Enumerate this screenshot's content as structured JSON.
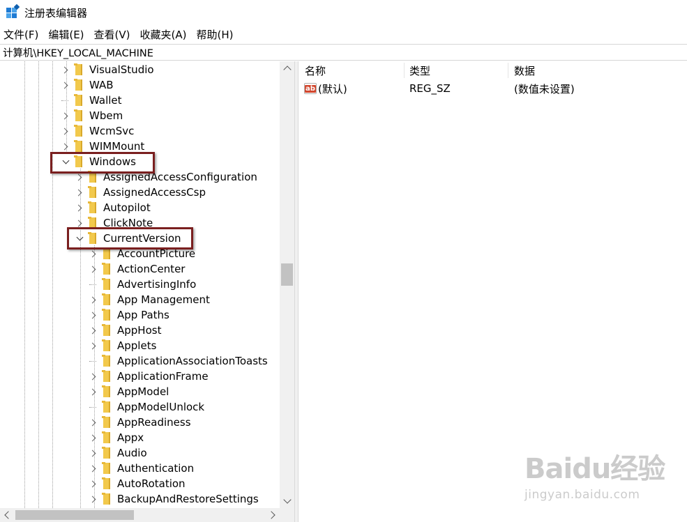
{
  "window": {
    "title": "注册表编辑器",
    "icon": "registry-editor-icon"
  },
  "menu": [
    "文件(F)",
    "编辑(E)",
    "查看(V)",
    "收藏夹(A)",
    "帮助(H)"
  ],
  "address": "计算机\\HKEY_LOCAL_MACHINE",
  "tree": {
    "items": [
      {
        "label": "VisualStudio",
        "expander": "collapsed",
        "level": 0
      },
      {
        "label": "WAB",
        "expander": "collapsed",
        "level": 0
      },
      {
        "label": "Wallet",
        "expander": "none",
        "level": 0
      },
      {
        "label": "Wbem",
        "expander": "collapsed",
        "level": 0
      },
      {
        "label": "WcmSvc",
        "expander": "collapsed",
        "level": 0
      },
      {
        "label": "WIMMount",
        "expander": "collapsed",
        "level": 0
      },
      {
        "label": "Windows",
        "expander": "expanded",
        "level": 0,
        "highlighted": true
      },
      {
        "label": "AssignedAccessConfiguration",
        "expander": "collapsed",
        "level": 1
      },
      {
        "label": "AssignedAccessCsp",
        "expander": "collapsed",
        "level": 1
      },
      {
        "label": "Autopilot",
        "expander": "collapsed",
        "level": 1
      },
      {
        "label": "ClickNote",
        "expander": "collapsed",
        "level": 1
      },
      {
        "label": "CurrentVersion",
        "expander": "expanded",
        "level": 1,
        "highlighted": true
      },
      {
        "label": "AccountPicture",
        "expander": "collapsed",
        "level": 2
      },
      {
        "label": "ActionCenter",
        "expander": "collapsed",
        "level": 2
      },
      {
        "label": "AdvertisingInfo",
        "expander": "none",
        "level": 2
      },
      {
        "label": "App Management",
        "expander": "collapsed",
        "level": 2
      },
      {
        "label": "App Paths",
        "expander": "collapsed",
        "level": 2
      },
      {
        "label": "AppHost",
        "expander": "collapsed",
        "level": 2
      },
      {
        "label": "Applets",
        "expander": "collapsed",
        "level": 2
      },
      {
        "label": "ApplicationAssociationToasts",
        "expander": "none",
        "level": 2
      },
      {
        "label": "ApplicationFrame",
        "expander": "collapsed",
        "level": 2
      },
      {
        "label": "AppModel",
        "expander": "collapsed",
        "level": 2
      },
      {
        "label": "AppModelUnlock",
        "expander": "none",
        "level": 2
      },
      {
        "label": "AppReadiness",
        "expander": "collapsed",
        "level": 2
      },
      {
        "label": "Appx",
        "expander": "collapsed",
        "level": 2
      },
      {
        "label": "Audio",
        "expander": "collapsed",
        "level": 2
      },
      {
        "label": "Authentication",
        "expander": "collapsed",
        "level": 2
      },
      {
        "label": "AutoRotation",
        "expander": "collapsed",
        "level": 2
      },
      {
        "label": "BackupAndRestoreSettings",
        "expander": "collapsed",
        "level": 2
      }
    ]
  },
  "list": {
    "columns": [
      "名称",
      "类型",
      "数据"
    ],
    "rows": [
      {
        "name": "(默认)",
        "type": "REG_SZ",
        "data": "(数值未设置)",
        "icon": "string-value-icon",
        "icon_text": "ab"
      }
    ]
  },
  "watermark": {
    "logo": "Baidu经验",
    "url": "jingyan.baidu.com"
  },
  "colors": {
    "highlight_box": "#7a1f1f",
    "folder": "#f2c94c"
  }
}
